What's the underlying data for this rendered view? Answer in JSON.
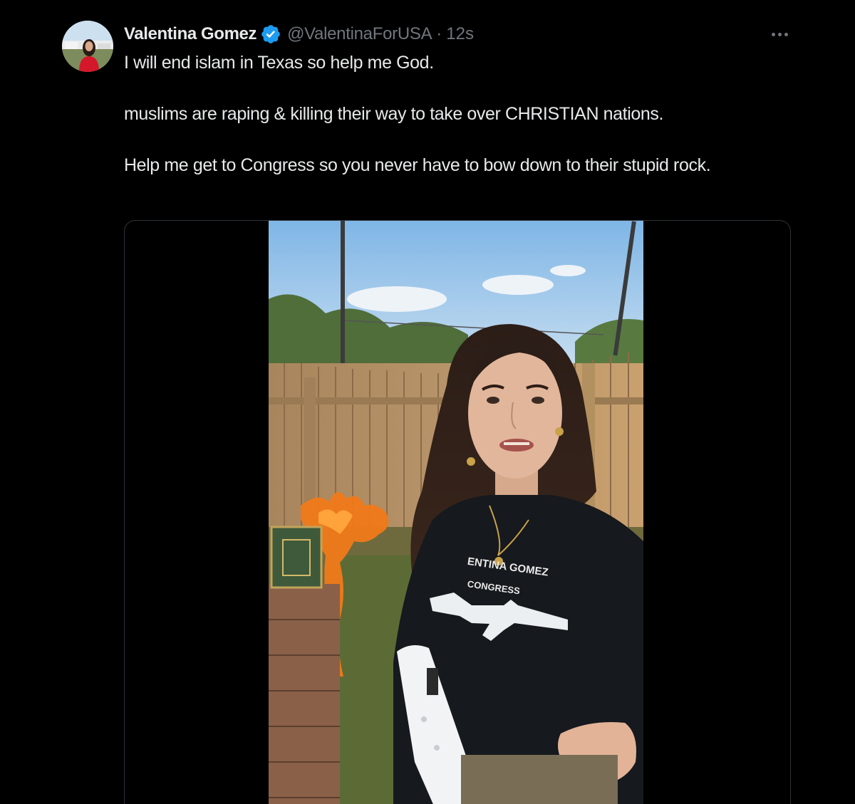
{
  "tweet": {
    "author": {
      "display_name": "Valentina Gomez",
      "handle": "@ValentinaForUSA",
      "verified": true
    },
    "timestamp": "12s",
    "separator": "·",
    "text_paragraphs": [
      "I will end islam in Texas so help me God.",
      "muslims are raping & killing their way to take over CHRISTIAN nations.",
      "Help me get to Congress so you never have to bow down to their stupid rock."
    ],
    "media": {
      "shirt_print_line1": "ENTINA GOMEZ",
      "shirt_print_line2": "CONGRESS"
    }
  },
  "icons": {
    "verified": "verified-badge-icon",
    "more": "more-horizontal-icon"
  },
  "colors": {
    "background": "#000000",
    "text_primary": "#e7e9ea",
    "text_secondary": "#71767b",
    "verified_blue": "#1d9bf0",
    "border": "#2f3336"
  }
}
